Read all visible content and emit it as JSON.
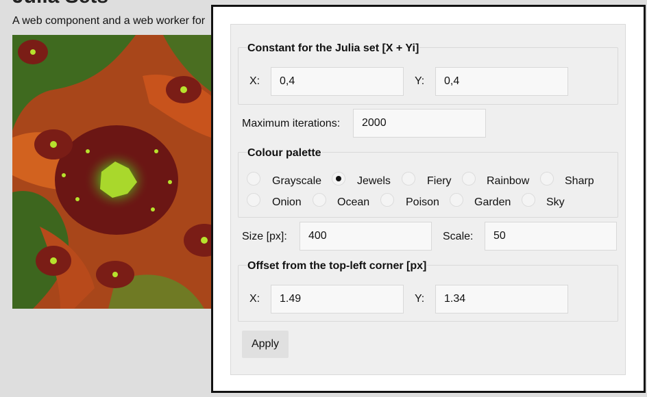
{
  "page": {
    "heading": "Julia Sets",
    "intro": "A web component and a web worker for"
  },
  "julia_constant": {
    "legend": "Constant for the Julia set [X + Yi]",
    "x_label": "X:",
    "x_value": "0,4",
    "y_label": "Y:",
    "y_value": "0,4"
  },
  "iterations": {
    "label": "Maximum iterations:",
    "value": "2000"
  },
  "palette": {
    "legend": "Colour palette",
    "selected": "Jewels",
    "options": [
      "Grayscale",
      "Jewels",
      "Fiery",
      "Rainbow",
      "Sharp",
      "Onion",
      "Ocean",
      "Poison",
      "Garden",
      "Sky"
    ]
  },
  "size": {
    "label": "Size [px]:",
    "value": "400"
  },
  "scale": {
    "label": "Scale:",
    "value": "50"
  },
  "offset": {
    "legend": "Offset from the top-left corner [px]",
    "x_label": "X:",
    "x_value": "1.49",
    "y_label": "Y:",
    "y_value": "1.34"
  },
  "apply_label": "Apply",
  "colors": {
    "fractal_green": "#3f6a1f",
    "fractal_orange": "#c8531c",
    "fractal_dark_red": "#6b1614",
    "fractal_lime": "#b7e22d",
    "dialog_border": "#111111",
    "panel_bg": "#efefef"
  }
}
